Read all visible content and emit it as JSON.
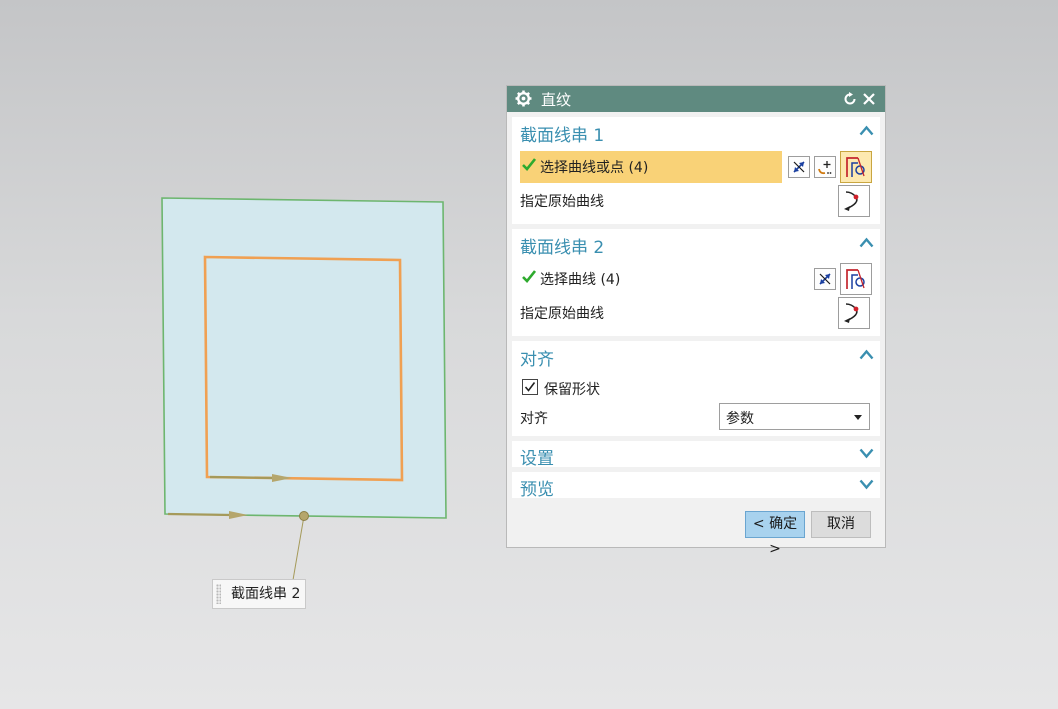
{
  "callout": {
    "label": "截面线串 2"
  },
  "dialog": {
    "title": "直纹",
    "groups": {
      "section1": {
        "title": "截面线串 1",
        "select_label": "选择曲线或点 (4)",
        "origin_label": "指定原始曲线"
      },
      "section2": {
        "title": "截面线串 2",
        "select_label": "选择曲线 (4)",
        "origin_label": "指定原始曲线"
      },
      "alignment": {
        "title": "对齐",
        "keep_shape_label": "保留形状",
        "keep_shape_checked": true,
        "align_label": "对齐",
        "align_value": "参数"
      },
      "settings": {
        "title": "设置"
      },
      "preview": {
        "title": "预览"
      }
    },
    "buttons": {
      "ok": "< 确定 >",
      "cancel": "取消"
    }
  },
  "colors": {
    "titlebar": "#5f8a80",
    "group_title": "#3a8fb0",
    "selected_row": "#f9d277",
    "surface_fill": "#d3e8ee",
    "outer_edge": "#6db66f",
    "inner_edge": "#f0a052",
    "ok_button": "#a8d2ee"
  }
}
